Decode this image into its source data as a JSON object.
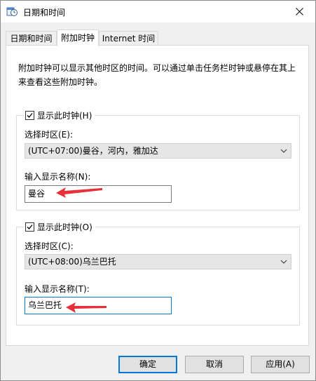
{
  "window": {
    "title": "日期和时间",
    "close_label": "×"
  },
  "tabs": [
    {
      "label": "日期和时间"
    },
    {
      "label": "附加时钟"
    },
    {
      "label": "Internet 时间"
    }
  ],
  "description": "附加时钟可以显示其他时区的时间。可以通过单击任务栏时钟或悬停在其上来查看这些附加时钟。",
  "clock1": {
    "show_label": "显示此时钟(H)",
    "checked": true,
    "timezone_label": "选择时区(E):",
    "timezone_value": "(UTC+07:00)曼谷，河内，雅加达",
    "name_label": "输入显示名称(N):",
    "name_value": "曼谷"
  },
  "clock2": {
    "show_label": "显示此时钟(O)",
    "checked": true,
    "timezone_label": "选择时区(C):",
    "timezone_value": "(UTC+08:00)乌兰巴托",
    "name_label": "输入显示名称(T):",
    "name_value": "乌兰巴托"
  },
  "buttons": {
    "ok": "确定",
    "cancel": "取消",
    "apply": "应用(A)"
  },
  "colors": {
    "accent": "#0078d7",
    "annotation_arrow": "#e8303a"
  }
}
